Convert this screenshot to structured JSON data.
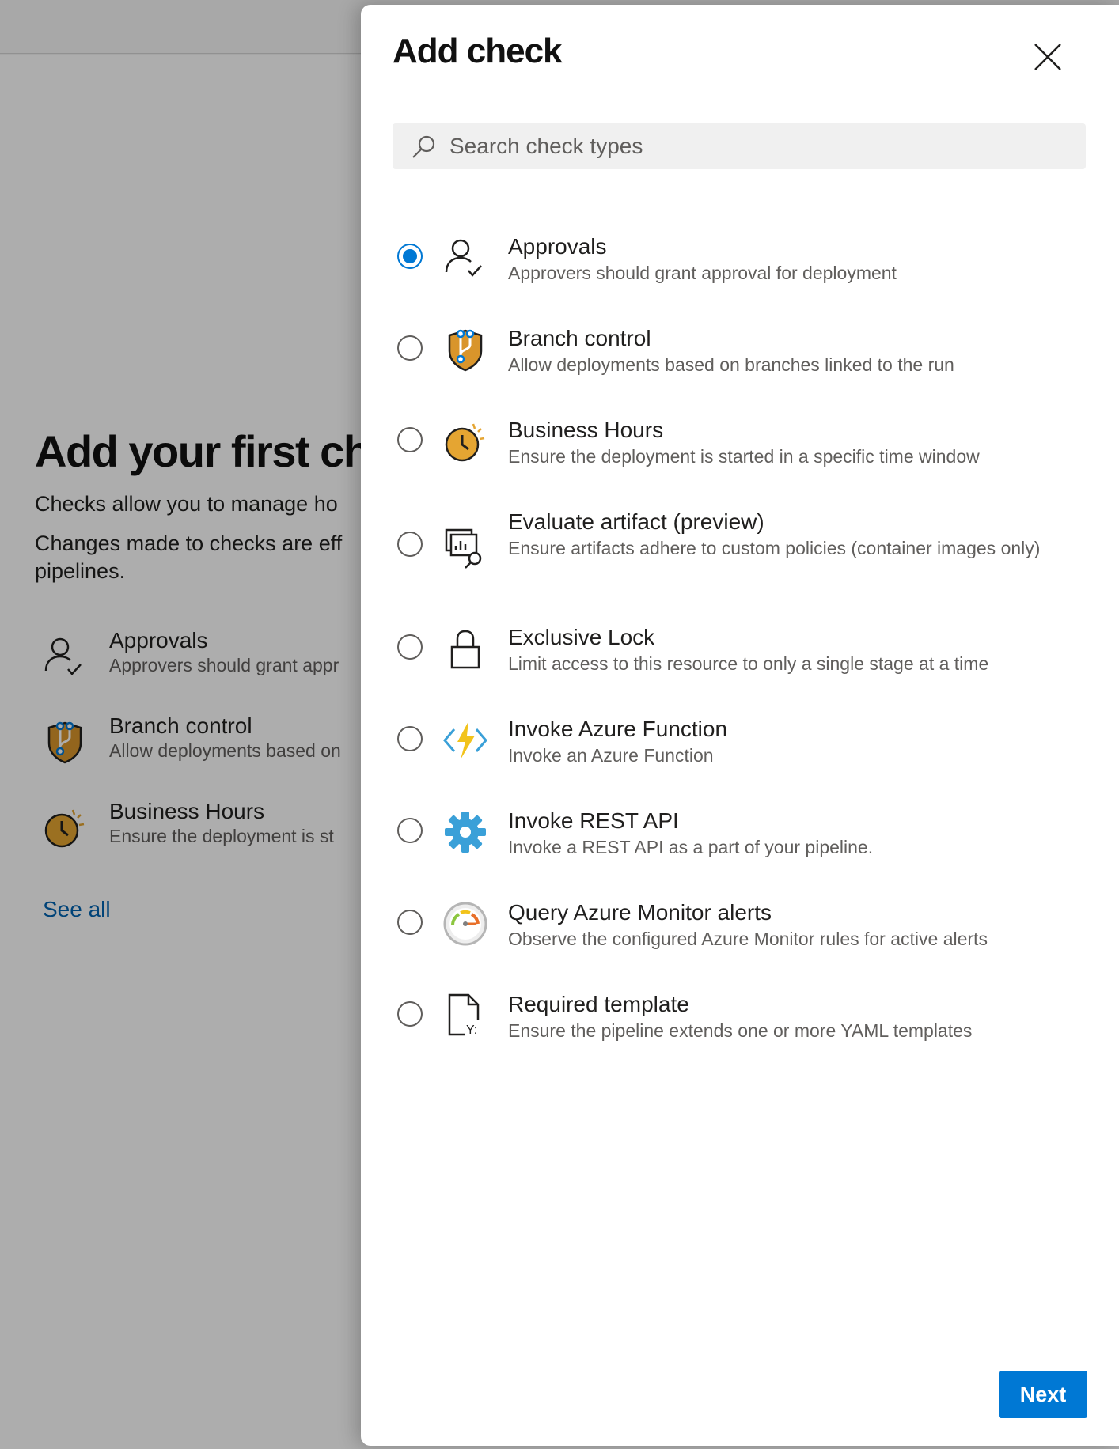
{
  "background": {
    "title": "Add your first che",
    "para1": "Checks allow you to manage ho",
    "para2": "Changes made to checks are eff pipelines.",
    "items": [
      {
        "title": "Approvals",
        "desc": "Approvers should grant appr"
      },
      {
        "title": "Branch control",
        "desc": "Allow deployments based on"
      },
      {
        "title": "Business Hours",
        "desc": "Ensure the deployment is st"
      }
    ],
    "see_all": "See all"
  },
  "panel": {
    "title": "Add check",
    "search": {
      "placeholder": "Search check types",
      "value": ""
    },
    "selected": "Approvals",
    "options": [
      {
        "title": "Approvals",
        "desc": "Approvers should grant approval for deployment",
        "icon": "approvals-icon",
        "selected": true
      },
      {
        "title": "Branch control",
        "desc": "Allow deployments based on branches linked to the run",
        "icon": "branch-control-icon",
        "selected": false
      },
      {
        "title": "Business Hours",
        "desc": "Ensure the deployment is started in a specific time window",
        "icon": "business-hours-icon",
        "selected": false
      },
      {
        "title": "Evaluate artifact (preview)",
        "desc": "Ensure artifacts adhere to custom policies (container images only)",
        "icon": "evaluate-artifact-icon",
        "selected": false
      },
      {
        "title": "Exclusive Lock",
        "desc": "Limit access to this resource to only a single stage at a time",
        "icon": "lock-icon",
        "selected": false
      },
      {
        "title": "Invoke Azure Function",
        "desc": "Invoke an Azure Function",
        "icon": "azure-function-icon",
        "selected": false
      },
      {
        "title": "Invoke REST API",
        "desc": "Invoke a REST API as a part of your pipeline.",
        "icon": "gear-icon",
        "selected": false
      },
      {
        "title": "Query Azure Monitor alerts",
        "desc": "Observe the configured Azure Monitor rules for active alerts",
        "icon": "monitor-gauge-icon",
        "selected": false
      },
      {
        "title": "Required template",
        "desc": "Ensure the pipeline extends one or more YAML templates",
        "icon": "yaml-template-icon",
        "selected": false
      }
    ],
    "next_label": "Next"
  },
  "colors": {
    "accent": "#0078d4",
    "link": "#0063b1",
    "shield": "#d9952b",
    "clock": "#e5a532"
  }
}
